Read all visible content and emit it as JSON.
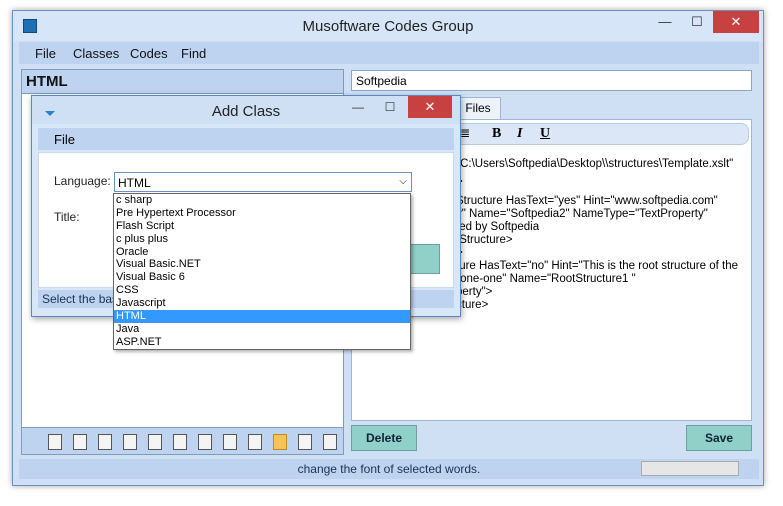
{
  "window": {
    "title": "Musoftware Codes Group",
    "controls": {
      "minimize": "—",
      "maximize": "☐",
      "close": "✕"
    }
  },
  "menu": [
    "File",
    "Classes",
    "Codes",
    "Find"
  ],
  "left_panel": {
    "header": "HTML"
  },
  "toolbar_icons": [
    "new-doc-icon",
    "folder-icon",
    "php-icon",
    "cpp-icon",
    "database-icon",
    "csharp-icon",
    "css-icon",
    "flash-icon",
    "java-icon",
    "html-globe-icon",
    "vb-icon",
    "xml-icon"
  ],
  "toolbar_selected": "html-globe-icon",
  "name_field": {
    "value": "Softpedia"
  },
  "tabs": {
    "files": "Files"
  },
  "format_bar": {
    "bold": "B",
    "italic": "I",
    "underline": "U",
    "list": "≣"
  },
  "code_lines": [
    "\"C:\\Users\\Softpedia\\Desktop\\\\structures\\Template.xslt\"",
    ">",
    "Structure HasText=\"yes\" Hint=\"www.softpedia.com\"",
    "y\" Name=\"Softpedia2\" NameType=\"TextProperty\"",
    "ted by Softpedia",
    "/Structure>",
    ">",
    "ture HasText=\"no\" Hint=\"This is the root structure of the",
    "\"one-one\" Name=\"RootStructure1 \"",
    "perty\">",
    "cture>"
  ],
  "buttons": {
    "delete": "Delete",
    "save": "Save"
  },
  "status": {
    "text": "change the font of selected words."
  },
  "dialog": {
    "title": "Add Class",
    "menu": "File",
    "language_label": "Language:",
    "title_label": "Title:",
    "selected_language": "HTML",
    "status_text": "Select the base",
    "controls": {
      "minimize": "—",
      "maximize": "☐",
      "close": "✕"
    }
  },
  "dropdown_options": [
    "c sharp",
    "Pre Hypertext Processor",
    "Flash Script",
    "c plus plus",
    "Oracle",
    "Visual Basic.NET",
    "Visual Basic 6",
    "CSS",
    "Javascript",
    "HTML",
    "Java",
    "ASP.NET"
  ],
  "dropdown_highlight": "HTML",
  "colors": {
    "accent": "#bdd3f0",
    "close": "#c74140",
    "button": "#8fd0c8",
    "highlight": "#3399ff"
  }
}
